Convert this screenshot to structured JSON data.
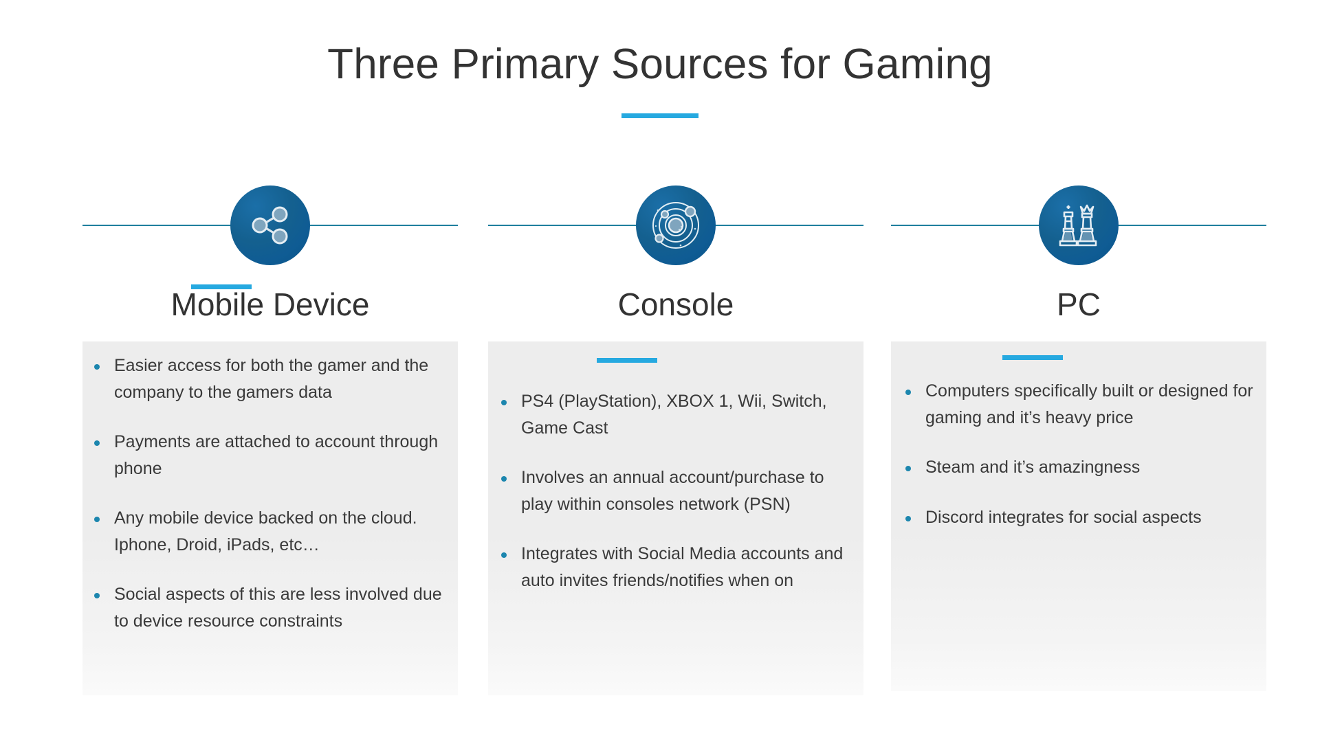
{
  "title": "Three Primary Sources for Gaming",
  "accent_color": "#26A9E0",
  "badge_color": "#10659D",
  "line_color": "#1F7F9E",
  "bullet_color": "#1C86AE",
  "panel_color": "#EDEDED",
  "columns": [
    {
      "icon": "share-network-icon",
      "heading": "Mobile Device",
      "bullets": [
        "Easier access for both the gamer and the company to the gamers data",
        "Payments are attached to account through phone",
        "Any mobile device backed on the cloud. Iphone, Droid, iPads, etc…",
        "Social aspects of this are less involved due to device resource constraints"
      ]
    },
    {
      "icon": "orbit-solar-system-icon",
      "heading": "Console",
      "bullets": [
        "PS4 (PlayStation), XBOX 1, Wii, Switch, Game Cast",
        "Involves an annual account/purchase to play within consoles network (PSN)",
        "Integrates with Social Media accounts and auto invites friends/notifies when on"
      ]
    },
    {
      "icon": "chess-pieces-icon",
      "heading": "PC",
      "bullets": [
        "Computers specifically built or designed for gaming and it’s heavy price",
        "Steam and it’s amazingness",
        "Discord integrates for social aspects"
      ]
    }
  ]
}
